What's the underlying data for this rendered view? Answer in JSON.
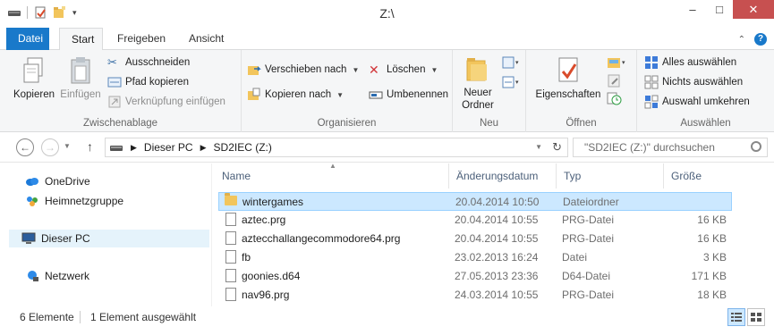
{
  "window": {
    "title": "Z:\\"
  },
  "tabs": [
    {
      "label": "Datei"
    },
    {
      "label": "Start"
    },
    {
      "label": "Freigeben"
    },
    {
      "label": "Ansicht"
    }
  ],
  "ribbon": {
    "clipboard": {
      "label": "Zwischenablage",
      "copy": "Kopieren",
      "paste": "Einfügen",
      "cut": "Ausschneiden",
      "copy_path": "Pfad kopieren",
      "paste_shortcut": "Verknüpfung einfügen"
    },
    "organize": {
      "label": "Organisieren",
      "move_to": "Verschieben nach",
      "copy_to": "Kopieren nach",
      "delete": "Löschen",
      "rename": "Umbenennen"
    },
    "new": {
      "label": "Neu",
      "new_folder_line1": "Neuer",
      "new_folder_line2": "Ordner"
    },
    "open": {
      "label": "Öffnen",
      "properties": "Eigenschaften"
    },
    "select": {
      "label": "Auswählen",
      "select_all": "Alles auswählen",
      "select_none": "Nichts auswählen",
      "invert": "Auswahl umkehren"
    }
  },
  "address": {
    "crumbs": [
      "Dieser PC",
      "SD2IEC (Z:)"
    ],
    "search_placeholder": "\"SD2IEC (Z:)\" durchsuchen"
  },
  "navpane": {
    "items": [
      {
        "label": "OneDrive",
        "icon": "cloud-icon"
      },
      {
        "label": "Heimnetzgruppe",
        "icon": "homegroup-icon"
      },
      {
        "label": "Dieser PC",
        "icon": "computer-icon"
      },
      {
        "label": "Netzwerk",
        "icon": "network-icon"
      }
    ]
  },
  "filelist": {
    "columns": [
      "Name",
      "Änderungsdatum",
      "Typ",
      "Größe"
    ],
    "rows": [
      {
        "name": "wintergames",
        "date": "20.04.2014 10:50",
        "type": "Dateiordner",
        "size": "",
        "kind": "folder"
      },
      {
        "name": "aztec.prg",
        "date": "20.04.2014 10:55",
        "type": "PRG-Datei",
        "size": "16 KB",
        "kind": "file"
      },
      {
        "name": "aztecchallangecommodore64.prg",
        "date": "20.04.2014 10:55",
        "type": "PRG-Datei",
        "size": "16 KB",
        "kind": "file"
      },
      {
        "name": "fb",
        "date": "23.02.2013 16:24",
        "type": "Datei",
        "size": "3 KB",
        "kind": "file"
      },
      {
        "name": "goonies.d64",
        "date": "27.05.2013 23:36",
        "type": "D64-Datei",
        "size": "171 KB",
        "kind": "file"
      },
      {
        "name": "nav96.prg",
        "date": "24.03.2014 10:55",
        "type": "PRG-Datei",
        "size": "18 KB",
        "kind": "file"
      }
    ]
  },
  "status": {
    "count": "6 Elemente",
    "selection": "1 Element ausgewählt"
  },
  "colors": {
    "accent": "#1979ca",
    "selection": "#cce8ff",
    "close": "#c75050"
  }
}
